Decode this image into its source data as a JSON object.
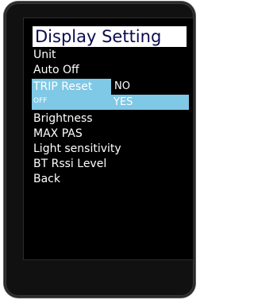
{
  "screen": {
    "title": "Display Setting",
    "menu_items": [
      {
        "label": "Unit"
      },
      {
        "label": "Auto Off"
      },
      {
        "label": "TRIP Reset",
        "value": "OFF"
      },
      {
        "label": "Brightness"
      },
      {
        "label": "MAX PAS"
      },
      {
        "label": "Light sensitivity"
      },
      {
        "label": "BT Rssi Level"
      },
      {
        "label": "Back"
      }
    ],
    "popup_options": [
      {
        "label": "NO"
      },
      {
        "label": "YES"
      }
    ]
  },
  "colors": {
    "background": "#000000",
    "title_background": "#ffffff",
    "title_text": "#0a0a50",
    "highlight": "#7fc8e6",
    "text": "#ffffff"
  }
}
